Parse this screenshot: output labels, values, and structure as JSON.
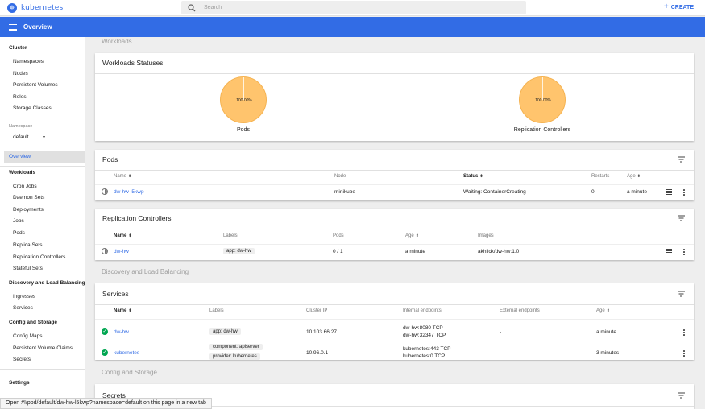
{
  "topbar": {
    "brand": "kubernetes",
    "search_placeholder": "Search",
    "create_label": "CREATE"
  },
  "appbar": {
    "title": "Overview"
  },
  "sidebar": {
    "cluster_heading": "Cluster",
    "cluster_items": [
      "Namespaces",
      "Nodes",
      "Persistent Volumes",
      "Roles",
      "Storage Classes"
    ],
    "namespace_label": "Namespace",
    "namespace_value": "default",
    "overview": "Overview",
    "workloads_heading": "Workloads",
    "workloads_items": [
      "Cron Jobs",
      "Daemon Sets",
      "Deployments",
      "Jobs",
      "Pods",
      "Replica Sets",
      "Replication Controllers",
      "Stateful Sets"
    ],
    "discovery_heading": "Discovery and Load Balancing",
    "discovery_items": [
      "Ingresses",
      "Services"
    ],
    "config_heading": "Config and Storage",
    "config_items": [
      "Config Maps",
      "Persistent Volume Claims",
      "Secrets"
    ],
    "settings": "Settings"
  },
  "sections": {
    "workloads": "Workloads",
    "discovery": "Discovery and Load Balancing",
    "config": "Config and Storage"
  },
  "workload_statuses": {
    "title": "Workloads Statuses",
    "charts": [
      {
        "label": "Pods",
        "percent": "100.00%",
        "running_fraction": 1.0
      },
      {
        "label": "Replication Controllers",
        "percent": "100.00%",
        "running_fraction": 1.0
      }
    ]
  },
  "pods": {
    "title": "Pods",
    "headers": {
      "name": "Name",
      "node": "Node",
      "status": "Status",
      "restarts": "Restarts",
      "age": "Age"
    },
    "rows": [
      {
        "name": "dw-hw-l5kwp",
        "node": "minikube",
        "status": "Waiting: ContainerCreating",
        "restarts": "0",
        "age": "a minute"
      }
    ]
  },
  "replication_controllers": {
    "title": "Replication Controllers",
    "headers": {
      "name": "Name",
      "labels": "Labels",
      "pods": "Pods",
      "age": "Age",
      "images": "Images"
    },
    "rows": [
      {
        "name": "dw-hw",
        "label": "app: dw-hw",
        "pods": "0 / 1",
        "age": "a minute",
        "images": "akhilck/dw-hw:1.0"
      }
    ]
  },
  "services": {
    "title": "Services",
    "headers": {
      "name": "Name",
      "labels": "Labels",
      "cluster_ip": "Cluster IP",
      "internal": "Internal endpoints",
      "external": "External endpoints",
      "age": "Age"
    },
    "rows": [
      {
        "name": "dw-hw",
        "labels": [
          "app: dw-hw"
        ],
        "cluster_ip": "10.103.66.27",
        "internal": [
          "dw-hw:8080 TCP",
          "dw-hw:32347 TCP"
        ],
        "external": "-",
        "age": "a minute"
      },
      {
        "name": "kubernetes",
        "labels": [
          "component: apiserver",
          "provider: kubernetes"
        ],
        "cluster_ip": "10.96.0.1",
        "internal": [
          "kubernetes:443 TCP",
          "kubernetes:0 TCP"
        ],
        "external": "-",
        "age": "3 minutes"
      }
    ]
  },
  "secrets": {
    "title": "Secrets"
  },
  "statusbar": {
    "text": "Open #!/pod/default/dw-hw-l5kwp?namespace=default on this page in a new tab"
  }
}
